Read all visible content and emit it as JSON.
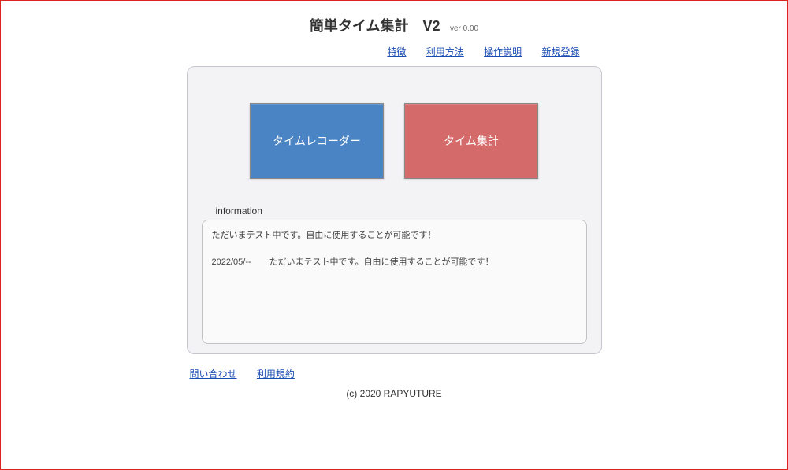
{
  "header": {
    "title": "簡単タイム集計　V2",
    "version": "ver 0.00"
  },
  "nav": {
    "features": "特徴",
    "usage": "利用方法",
    "instructions": "操作説明",
    "register": "新規登録"
  },
  "buttons": {
    "recorder": "タイムレコーダー",
    "summary": "タイム集計"
  },
  "info": {
    "label": "information",
    "line1": "ただいまテスト中です。自由に使用することが可能です！",
    "line2_date": "2022/05/--",
    "line2_text": "ただいまテスト中です。自由に使用することが可能です！"
  },
  "footer": {
    "contact": "問い合わせ",
    "terms": "利用規約",
    "copyright": "(c) 2020  RAPYUTURE"
  }
}
